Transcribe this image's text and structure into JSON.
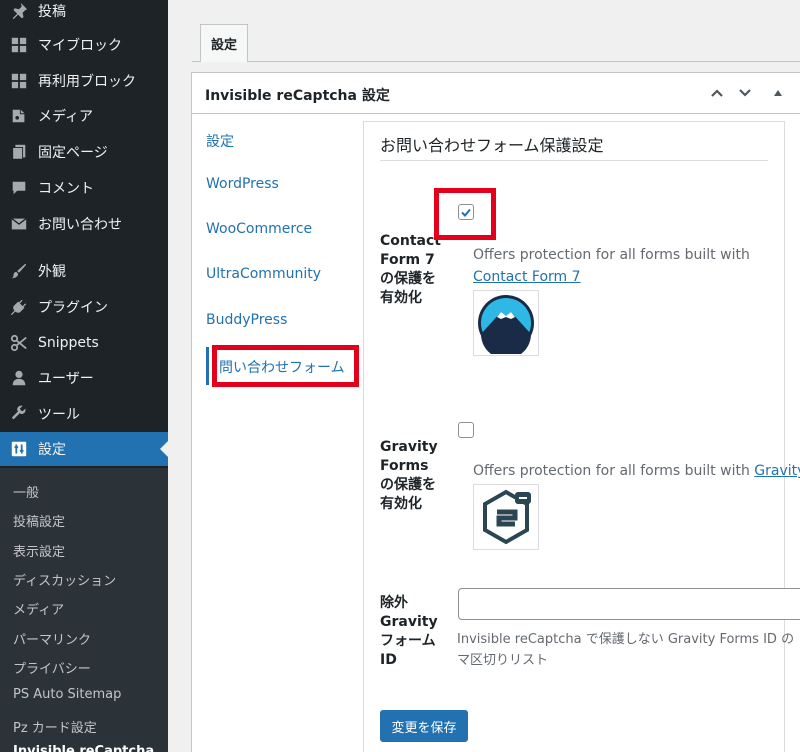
{
  "sidebar": {
    "items": [
      {
        "label": "投稿",
        "icon": "pin-icon"
      },
      {
        "label": "マイブロック",
        "icon": "grid-icon"
      },
      {
        "label": "再利用ブロック",
        "icon": "grid-icon"
      },
      {
        "label": "メディア",
        "icon": "media-icon"
      },
      {
        "label": "固定ページ",
        "icon": "page-icon"
      },
      {
        "label": "コメント",
        "icon": "comment-icon"
      },
      {
        "label": "お問い合わせ",
        "icon": "mail-icon"
      },
      {
        "label": "外観",
        "icon": "brush-icon"
      },
      {
        "label": "プラグイン",
        "icon": "plug-icon"
      },
      {
        "label": "Snippets",
        "icon": "scissors-icon"
      },
      {
        "label": "ユーザー",
        "icon": "user-icon"
      },
      {
        "label": "ツール",
        "icon": "wrench-icon"
      },
      {
        "label": "設定",
        "icon": "settings-icon"
      }
    ],
    "submenu": [
      "一般",
      "投稿設定",
      "表示設定",
      "ディスカッション",
      "メディア",
      "パーマリンク",
      "プライバシー",
      "PS Auto Sitemap",
      "Pz カード設定",
      "Invisible reCaptcha"
    ]
  },
  "main": {
    "tab_label": "設定",
    "postbox_title": "Invisible reCaptcha 設定",
    "vertical_tabs": [
      "設定",
      "WordPress",
      "WooCommerce",
      "UltraCommunity",
      "BuddyPress",
      "問い合わせフォーム"
    ],
    "panel": {
      "title": "お問い合わせフォーム保護設定",
      "cf7": {
        "label_lines": [
          "Contact",
          "Form 7",
          "の保護を",
          "有効化"
        ],
        "checked": true,
        "description": "Offers protection for all forms built with",
        "link": "Contact Form 7"
      },
      "gravity": {
        "label_lines": [
          "Gravity",
          "Forms",
          "の保護を",
          "有効化"
        ],
        "checked": false,
        "description": "Offers protection for all forms built with",
        "link": "Gravity F"
      },
      "exclude": {
        "label_lines": [
          "除外",
          "Gravity",
          "フォーム",
          "ID"
        ],
        "value": "",
        "help_line1": "Invisible reCaptcha で保護しない Gravity Forms ID の",
        "help_line2": "マ区切りリスト"
      },
      "save_label": "変更を保存"
    }
  },
  "colors": {
    "sidebar_bg": "#1d2327",
    "accent": "#2271b1",
    "highlight_box": "#e3001b"
  }
}
